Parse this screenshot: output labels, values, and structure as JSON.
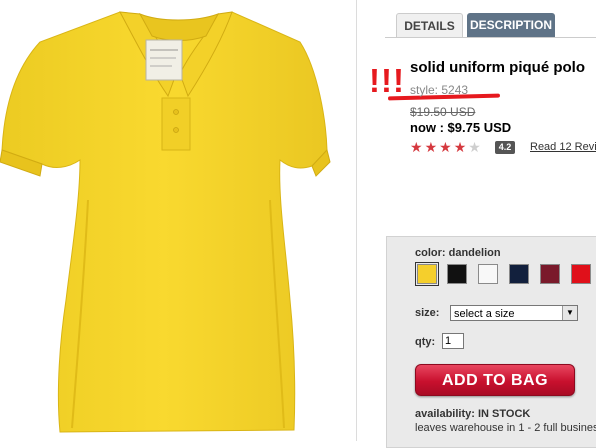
{
  "product_image": {
    "shirt_color": "#f7d32a",
    "shirt_shadow": "#e3bb17",
    "tag_text": "aeropostale"
  },
  "tabs": [
    {
      "label": "DETAILS",
      "active": true
    },
    {
      "label": "DESCRIPTION",
      "active": false
    }
  ],
  "annotation": {
    "marks": "!!!",
    "color": "#e6191e"
  },
  "product": {
    "title": "solid uniform piqué polo",
    "style": "style: 5243",
    "original_price": "$19.50 USD",
    "sale_price": "now : $9.75 USD",
    "rating": {
      "stars_filled": 4,
      "stars_total": 5,
      "score": "4.2"
    },
    "reviews_link": "Read 12 Revie"
  },
  "options": {
    "color_label": "color:",
    "color_value": "dandelion",
    "swatches": [
      {
        "name": "dandelion",
        "hex": "#f5cf2c"
      },
      {
        "name": "black",
        "hex": "#111111"
      },
      {
        "name": "white",
        "hex": "#f8f8f8"
      },
      {
        "name": "navy",
        "hex": "#12203d"
      },
      {
        "name": "burgundy",
        "hex": "#7a1a2b"
      },
      {
        "name": "red",
        "hex": "#e0101a"
      }
    ],
    "size_label": "size:",
    "size_value": "select a size",
    "qty_label": "qty:",
    "qty_value": "1",
    "add_button": "ADD TO BAG"
  },
  "availability": {
    "label": "availability:",
    "status": "IN STOCK",
    "shipping": "leaves warehouse in 1 - 2 full busines"
  },
  "icons": {
    "dropdown": "chevron-down-icon",
    "star": "star-icon"
  }
}
